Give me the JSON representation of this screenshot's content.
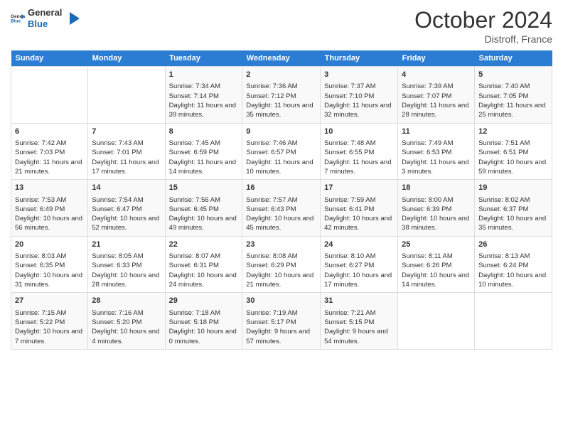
{
  "header": {
    "logo_line1": "General",
    "logo_line2": "Blue",
    "month_title": "October 2024",
    "location": "Distroff, France"
  },
  "days_of_week": [
    "Sunday",
    "Monday",
    "Tuesday",
    "Wednesday",
    "Thursday",
    "Friday",
    "Saturday"
  ],
  "weeks": [
    [
      {
        "day": "",
        "info": ""
      },
      {
        "day": "",
        "info": ""
      },
      {
        "day": "1",
        "info": "Sunrise: 7:34 AM\nSunset: 7:14 PM\nDaylight: 11 hours and 39 minutes."
      },
      {
        "day": "2",
        "info": "Sunrise: 7:36 AM\nSunset: 7:12 PM\nDaylight: 11 hours and 35 minutes."
      },
      {
        "day": "3",
        "info": "Sunrise: 7:37 AM\nSunset: 7:10 PM\nDaylight: 11 hours and 32 minutes."
      },
      {
        "day": "4",
        "info": "Sunrise: 7:39 AM\nSunset: 7:07 PM\nDaylight: 11 hours and 28 minutes."
      },
      {
        "day": "5",
        "info": "Sunrise: 7:40 AM\nSunset: 7:05 PM\nDaylight: 11 hours and 25 minutes."
      }
    ],
    [
      {
        "day": "6",
        "info": "Sunrise: 7:42 AM\nSunset: 7:03 PM\nDaylight: 11 hours and 21 minutes."
      },
      {
        "day": "7",
        "info": "Sunrise: 7:43 AM\nSunset: 7:01 PM\nDaylight: 11 hours and 17 minutes."
      },
      {
        "day": "8",
        "info": "Sunrise: 7:45 AM\nSunset: 6:59 PM\nDaylight: 11 hours and 14 minutes."
      },
      {
        "day": "9",
        "info": "Sunrise: 7:46 AM\nSunset: 6:57 PM\nDaylight: 11 hours and 10 minutes."
      },
      {
        "day": "10",
        "info": "Sunrise: 7:48 AM\nSunset: 6:55 PM\nDaylight: 11 hours and 7 minutes."
      },
      {
        "day": "11",
        "info": "Sunrise: 7:49 AM\nSunset: 6:53 PM\nDaylight: 11 hours and 3 minutes."
      },
      {
        "day": "12",
        "info": "Sunrise: 7:51 AM\nSunset: 6:51 PM\nDaylight: 10 hours and 59 minutes."
      }
    ],
    [
      {
        "day": "13",
        "info": "Sunrise: 7:53 AM\nSunset: 6:49 PM\nDaylight: 10 hours and 56 minutes."
      },
      {
        "day": "14",
        "info": "Sunrise: 7:54 AM\nSunset: 6:47 PM\nDaylight: 10 hours and 52 minutes."
      },
      {
        "day": "15",
        "info": "Sunrise: 7:56 AM\nSunset: 6:45 PM\nDaylight: 10 hours and 49 minutes."
      },
      {
        "day": "16",
        "info": "Sunrise: 7:57 AM\nSunset: 6:43 PM\nDaylight: 10 hours and 45 minutes."
      },
      {
        "day": "17",
        "info": "Sunrise: 7:59 AM\nSunset: 6:41 PM\nDaylight: 10 hours and 42 minutes."
      },
      {
        "day": "18",
        "info": "Sunrise: 8:00 AM\nSunset: 6:39 PM\nDaylight: 10 hours and 38 minutes."
      },
      {
        "day": "19",
        "info": "Sunrise: 8:02 AM\nSunset: 6:37 PM\nDaylight: 10 hours and 35 minutes."
      }
    ],
    [
      {
        "day": "20",
        "info": "Sunrise: 8:03 AM\nSunset: 6:35 PM\nDaylight: 10 hours and 31 minutes."
      },
      {
        "day": "21",
        "info": "Sunrise: 8:05 AM\nSunset: 6:33 PM\nDaylight: 10 hours and 28 minutes."
      },
      {
        "day": "22",
        "info": "Sunrise: 8:07 AM\nSunset: 6:31 PM\nDaylight: 10 hours and 24 minutes."
      },
      {
        "day": "23",
        "info": "Sunrise: 8:08 AM\nSunset: 6:29 PM\nDaylight: 10 hours and 21 minutes."
      },
      {
        "day": "24",
        "info": "Sunrise: 8:10 AM\nSunset: 6:27 PM\nDaylight: 10 hours and 17 minutes."
      },
      {
        "day": "25",
        "info": "Sunrise: 8:11 AM\nSunset: 6:26 PM\nDaylight: 10 hours and 14 minutes."
      },
      {
        "day": "26",
        "info": "Sunrise: 8:13 AM\nSunset: 6:24 PM\nDaylight: 10 hours and 10 minutes."
      }
    ],
    [
      {
        "day": "27",
        "info": "Sunrise: 7:15 AM\nSunset: 5:22 PM\nDaylight: 10 hours and 7 minutes."
      },
      {
        "day": "28",
        "info": "Sunrise: 7:16 AM\nSunset: 5:20 PM\nDaylight: 10 hours and 4 minutes."
      },
      {
        "day": "29",
        "info": "Sunrise: 7:18 AM\nSunset: 5:18 PM\nDaylight: 10 hours and 0 minutes."
      },
      {
        "day": "30",
        "info": "Sunrise: 7:19 AM\nSunset: 5:17 PM\nDaylight: 9 hours and 57 minutes."
      },
      {
        "day": "31",
        "info": "Sunrise: 7:21 AM\nSunset: 5:15 PM\nDaylight: 9 hours and 54 minutes."
      },
      {
        "day": "",
        "info": ""
      },
      {
        "day": "",
        "info": ""
      }
    ]
  ]
}
